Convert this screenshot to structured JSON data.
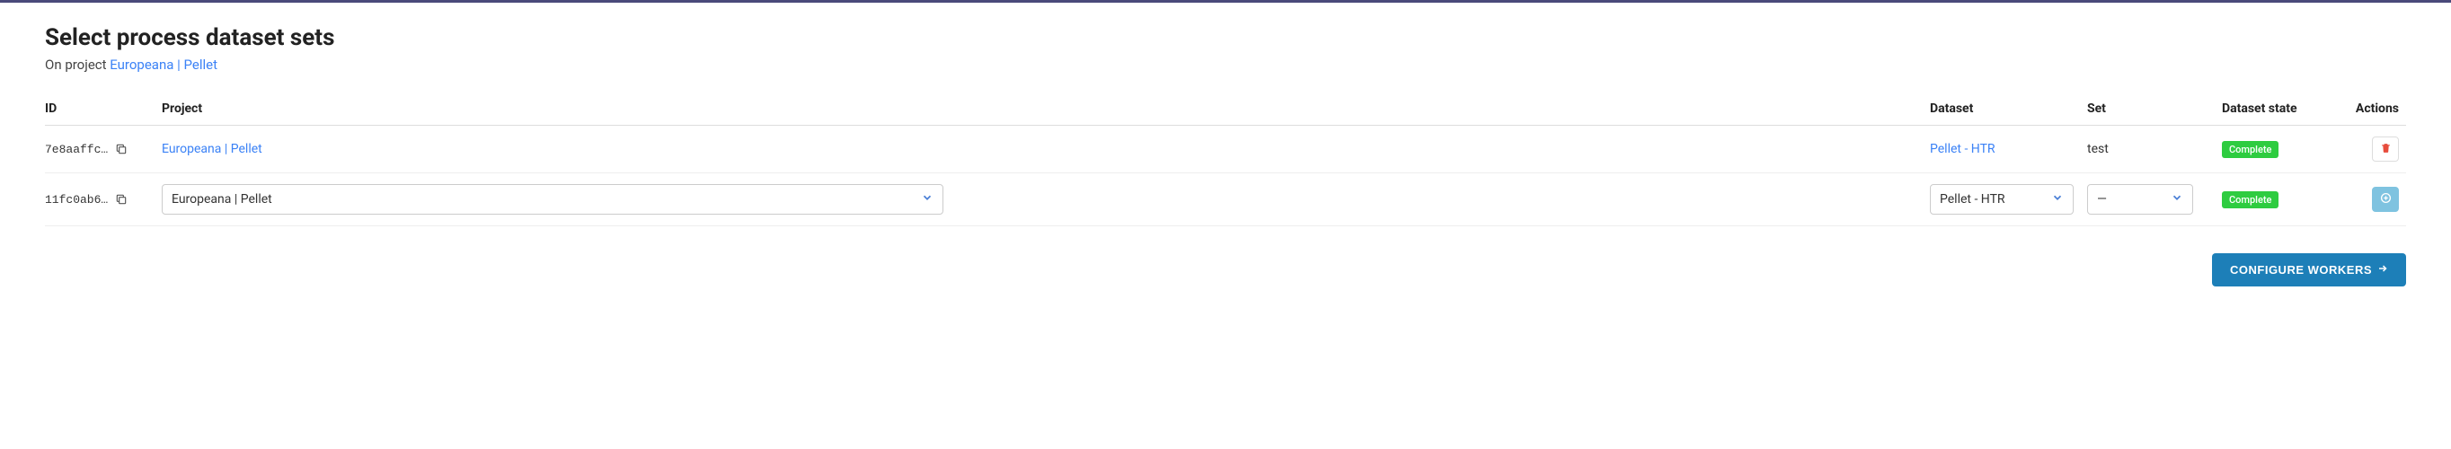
{
  "header": {
    "title": "Select process dataset sets",
    "subtitle_prefix": "On project ",
    "project_link": "Europeana | Pellet"
  },
  "table": {
    "headers": {
      "id": "ID",
      "project": "Project",
      "dataset": "Dataset",
      "set": "Set",
      "state": "Dataset state",
      "actions": "Actions"
    },
    "rows": [
      {
        "id": "7e8aaffc…",
        "project": "Europeana | Pellet",
        "dataset": "Pellet - HTR",
        "set": "test",
        "state": "Complete",
        "action": "delete"
      },
      {
        "id": "11fc0ab6…",
        "project_select": "Europeana | Pellet",
        "dataset_select": "Pellet - HTR",
        "set_select": "—",
        "state": "Complete",
        "action": "add"
      }
    ]
  },
  "footer": {
    "configure_label": "CONFIGURE WORKERS"
  }
}
